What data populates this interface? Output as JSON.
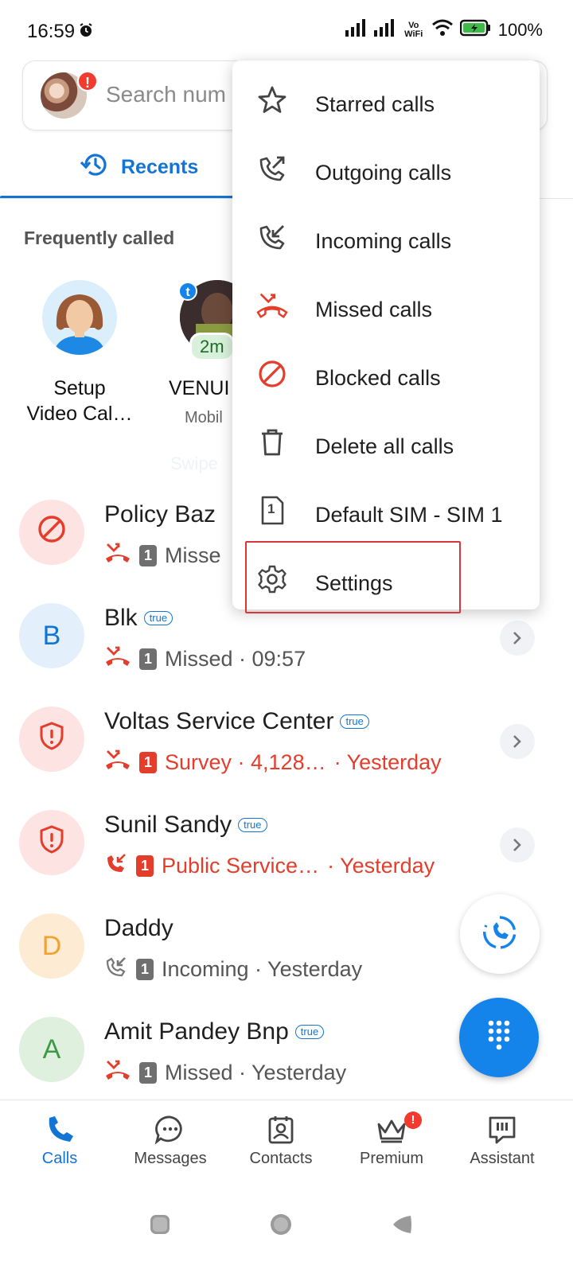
{
  "status_bar": {
    "time": "16:59",
    "battery": "100%",
    "vowifi_top": "Vo",
    "vowifi_bottom": "WiFi"
  },
  "search": {
    "placeholder": "Search num",
    "avatar_badge": "!"
  },
  "tabs": {
    "recents": "Recents"
  },
  "frequently_called": {
    "title": "Frequently called",
    "items": [
      {
        "name_line1": "Setup",
        "name_line2": "Video Cal…",
        "sub": ""
      },
      {
        "name_line1": "VENUI",
        "name_line2": "",
        "sub": "Mobil",
        "duration": "2m",
        "badge": "t"
      }
    ],
    "swipe_hint": "Swipe"
  },
  "calls": [
    {
      "name": "Policy Baz",
      "detail": "Misse",
      "avatar_icon": "block-icon",
      "call_type": "missed",
      "sim": "1",
      "red": false
    },
    {
      "name": "Blk",
      "badge": "true",
      "detail": "Missed · 09:57",
      "avatar_letter": "B",
      "call_type": "missed",
      "sim": "1",
      "red": false
    },
    {
      "name": "Voltas Service Center",
      "badge": "true",
      "detail": "Survey · 4,128…",
      "time": "· Yesterday",
      "avatar_icon": "shield-icon",
      "call_type": "missed",
      "sim": "1",
      "red": true
    },
    {
      "name": "Sunil Sandy",
      "badge": "true",
      "detail": "Public Service…",
      "time": "· Yesterday",
      "avatar_icon": "shield-icon",
      "call_type": "incoming",
      "sim": "1",
      "red": true
    },
    {
      "name": "Daddy",
      "detail": "Incoming · Yesterday",
      "avatar_letter": "D",
      "call_type": "incoming",
      "sim": "1",
      "red": false
    },
    {
      "name": "Amit Pandey Bnp",
      "badge": "true",
      "detail": "Missed · Yesterday",
      "avatar_letter": "A",
      "call_type": "missed",
      "sim": "1",
      "red": false
    }
  ],
  "menu": {
    "items": [
      {
        "label": "Starred calls",
        "icon": "star-icon"
      },
      {
        "label": "Outgoing calls",
        "icon": "outgoing-call-icon"
      },
      {
        "label": "Incoming calls",
        "icon": "incoming-call-icon"
      },
      {
        "label": "Missed calls",
        "icon": "missed-call-icon"
      },
      {
        "label": "Blocked calls",
        "icon": "block-icon"
      },
      {
        "label": "Delete all calls",
        "icon": "trash-icon"
      },
      {
        "label": "Default SIM - SIM 1",
        "icon": "sim-icon",
        "sim_digit": "1"
      },
      {
        "label": "Settings",
        "icon": "gear-icon"
      }
    ]
  },
  "bottom_nav": {
    "items": [
      {
        "label": "Calls",
        "active": true
      },
      {
        "label": "Messages"
      },
      {
        "label": "Contacts"
      },
      {
        "label": "Premium",
        "badge": "!"
      },
      {
        "label": "Assistant"
      }
    ]
  },
  "colors": {
    "accent": "#1275d6",
    "missed_red": "#e53d2c",
    "fab_blue": "#1483ea",
    "highlight": "#d9363a"
  }
}
